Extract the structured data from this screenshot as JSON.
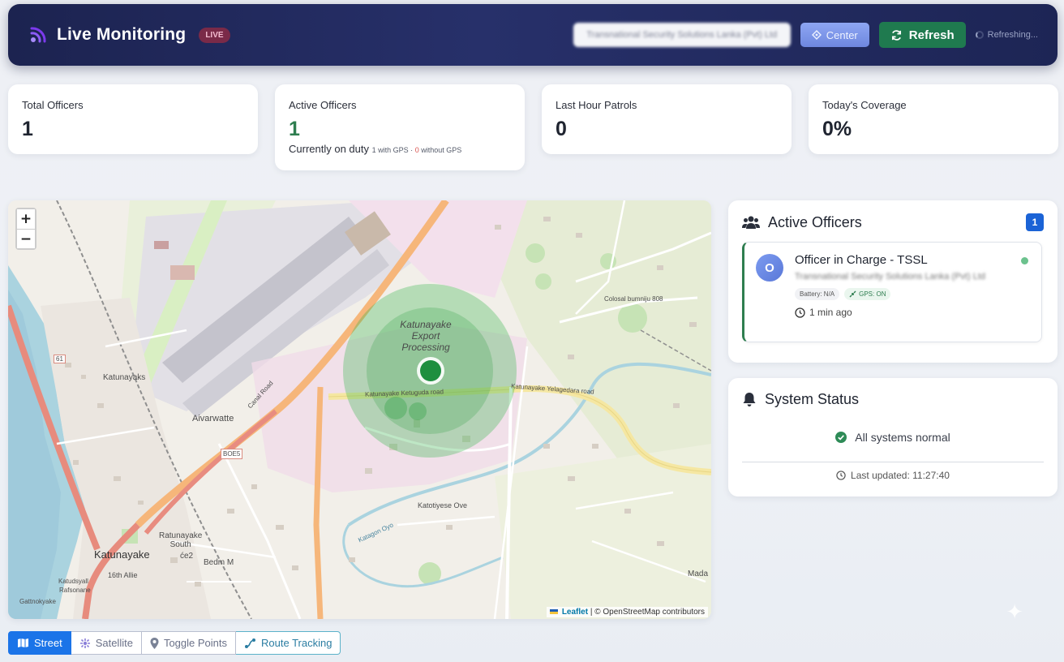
{
  "header": {
    "title": "Live Monitoring",
    "live_badge": "LIVE",
    "company_select_value": "Transnational Security Solutions Lanka (Pvt) Ltd",
    "center_label": "Center",
    "refresh_label": "Refresh",
    "refreshing_label": "Refreshing..."
  },
  "stats": {
    "total_officers": {
      "label": "Total Officers",
      "value": "1"
    },
    "active_officers": {
      "label": "Active Officers",
      "value": "1",
      "sub_label": "Currently on duty",
      "with_gps_count": "1",
      "with_gps_label": "with GPS ·",
      "without_gps_count": "0",
      "without_gps_label": "without GPS"
    },
    "last_hour_patrols": {
      "label": "Last Hour Patrols",
      "value": "0"
    },
    "todays_coverage": {
      "label": "Today's Coverage",
      "value": "0%"
    }
  },
  "map": {
    "zoom_in": "+",
    "zoom_out": "−",
    "attribution_link": "Leaflet",
    "attribution_text": "| © OpenStreetMap contributors",
    "labels": {
      "export_zone_1": "Katunayake",
      "export_zone_2": "Export",
      "export_zone_3": "Processing",
      "katunayake": "Katunayake",
      "katunayaks": "Katunayaks",
      "avarwatte": "Aivarwatte",
      "ketuguda_road": "Katunayake Ketuguda road",
      "yelagedara_road": "Katunayake Yelagedara road",
      "canal_road": "Canal Road",
      "ratunayake_south_1": "Ratunayake",
      "ratunayake_south_2": "South",
      "ce2": "će2",
      "bedm": "Bedm M",
      "16th_allie": "16th Allie",
      "gattnokyake": "Gattnokyake",
      "katudsyall": "Katudsyall",
      "rafsonane": "Rafsonane",
      "katotiyese": "Katotiyese Ove",
      "kalegaon": "Katagon Oyo",
      "bo05": "BOE5",
      "b61": "61",
      "mada": "Mada",
      "colombo_road": "Colosal bumniju 808"
    }
  },
  "map_toolbar": {
    "street": "Street",
    "satellite": "Satellite",
    "toggle_points": "Toggle Points",
    "route_tracking": "Route Tracking"
  },
  "active_officers_panel": {
    "title": "Active Officers",
    "count": "1",
    "officer": {
      "avatar": "O",
      "name": "Officer in Charge - TSSL",
      "company": "Transnational Security Solutions Lanka (Pvt) Ltd",
      "battery": "Battery: N/A",
      "gps": "GPS: ON",
      "last_seen": "1 min ago"
    }
  },
  "system_status_panel": {
    "title": "System Status",
    "status": "All systems normal",
    "last_updated": "Last updated: 11:27:40"
  },
  "colors": {
    "header_bg": "#1c2350",
    "refresh_btn": "#1f7a4f",
    "center_btn": "#7e97ea",
    "active_green": "#2e7d4f",
    "badge_blue": "#1b63d6",
    "street_active": "#1b74e8"
  }
}
